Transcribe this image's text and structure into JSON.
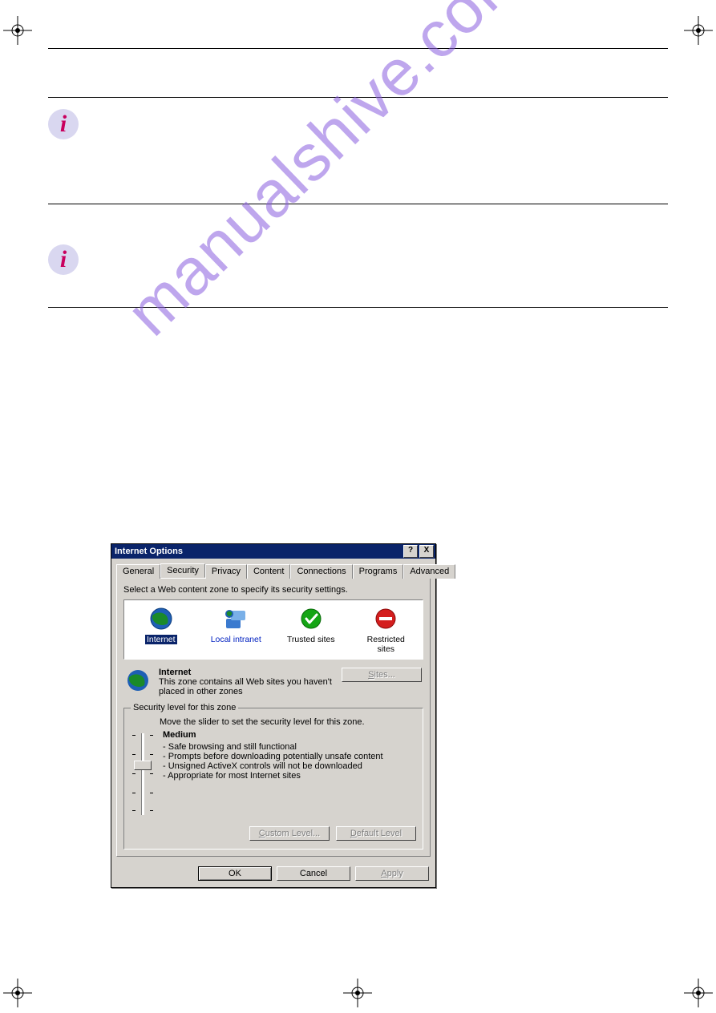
{
  "watermark": "manualshive.com",
  "dialog": {
    "title": "Internet Options",
    "help_btn": "?",
    "close_btn": "X",
    "tabs": [
      "General",
      "Security",
      "Privacy",
      "Content",
      "Connections",
      "Programs",
      "Advanced"
    ],
    "active_tab": "Security",
    "zone_prompt": "Select a Web content zone to specify its security settings.",
    "zones": [
      {
        "name": "Internet",
        "selected": true
      },
      {
        "name": "Local intranet",
        "selected": false
      },
      {
        "name": "Trusted sites",
        "selected": false
      },
      {
        "name": "Restricted sites",
        "selected": false
      }
    ],
    "current_zone": {
      "title": "Internet",
      "desc": "This zone contains all Web sites you haven't placed in other zones"
    },
    "sites_btn": "Sites...",
    "security_group_label": "Security level for this zone",
    "slider_instruction": "Move the slider to set the security level for this zone.",
    "level_name": "Medium",
    "level_bullets": [
      "Safe browsing and still functional",
      "Prompts before downloading potentially unsafe content",
      "Unsigned ActiveX controls will not be downloaded",
      "Appropriate for most Internet sites"
    ],
    "custom_level_btn": "Custom Level...",
    "default_level_btn": "Default Level",
    "ok_btn": "OK",
    "cancel_btn": "Cancel",
    "apply_btn": "Apply"
  }
}
